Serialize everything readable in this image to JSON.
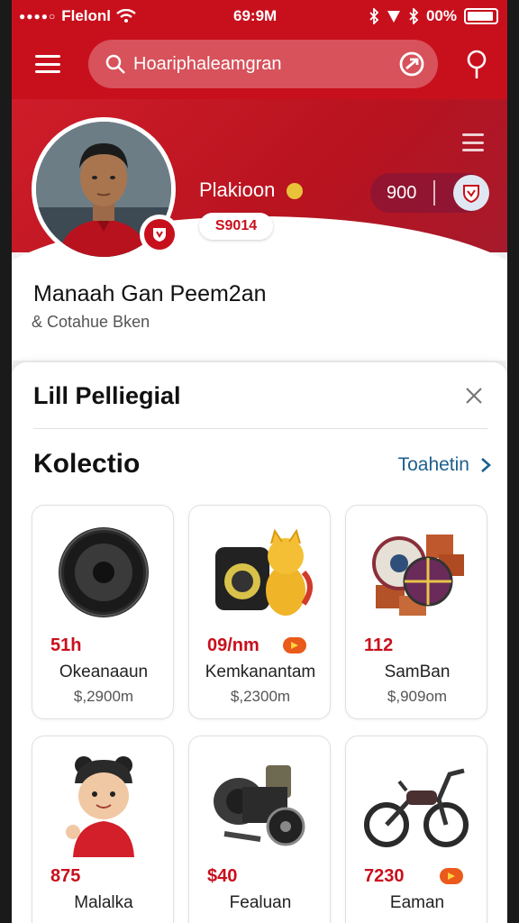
{
  "status_bar": {
    "carrier": "Flelonl",
    "time": "69:9M",
    "battery": "00%"
  },
  "top_bar": {
    "search_value": "Hoariphaleamgran",
    "icons": [
      "menu-icon",
      "search-icon",
      "camera-icon",
      "location-pin-icon"
    ]
  },
  "profile": {
    "player_name": "Plakioon",
    "score": "S9014",
    "coins": "900",
    "full_name": "Manaah Gan Peem2an",
    "subtitle": "& Cotahue Bken"
  },
  "sheet": {
    "title": "Lill Pelliegial",
    "collection_title": "Kolectio",
    "view_all_label": "Toahetin"
  },
  "products": [
    {
      "price": "51h",
      "name": "Okeanaaun",
      "sub": "$,2900m",
      "badge": false,
      "icon": "speaker-icon"
    },
    {
      "price": "09/nm",
      "name": "Kemkanantam",
      "sub": "$,2300m",
      "badge": true,
      "icon": "cat-radio-icon"
    },
    {
      "price": "112",
      "name": "SamBan",
      "sub": "$,909om",
      "badge": false,
      "icon": "wheel-items-icon"
    },
    {
      "price": "875",
      "name": "Malalka",
      "sub": "",
      "badge": false,
      "icon": "avatar-figure-icon"
    },
    {
      "price": "$40",
      "name": "Fealuan",
      "sub": "",
      "badge": false,
      "icon": "cannon-icon"
    },
    {
      "price": "7230",
      "name": "Eaman",
      "sub": "",
      "badge": true,
      "icon": "motorbike-icon"
    }
  ],
  "colors": {
    "brand": "#c8101d",
    "accent_link": "#1d5f8e",
    "badge": "#ea5a1a"
  }
}
